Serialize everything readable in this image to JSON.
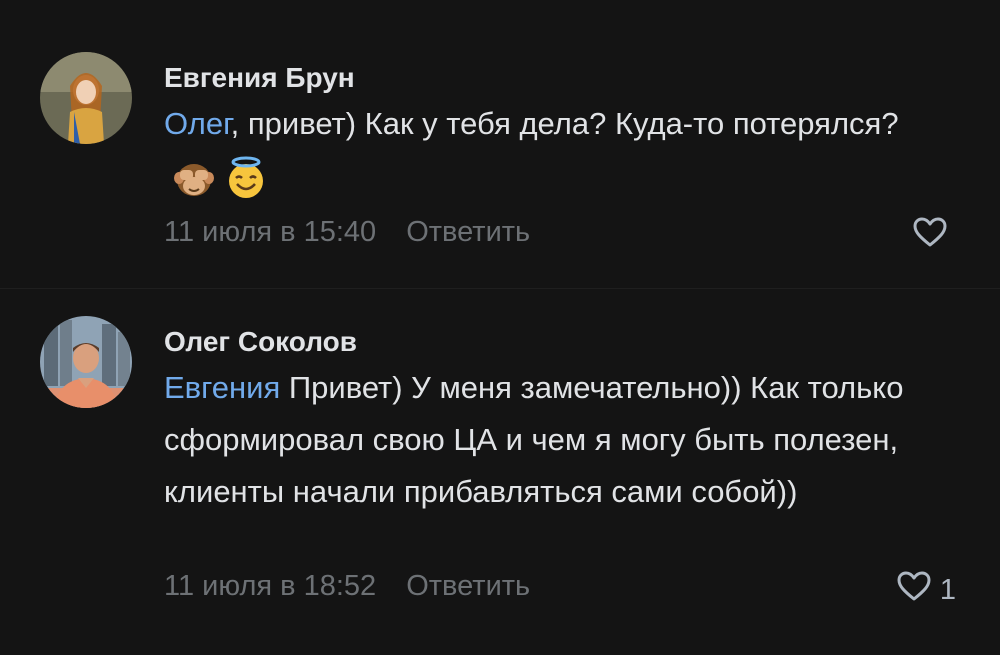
{
  "comments": [
    {
      "author": "Евгения Брун",
      "mention": "Олег",
      "text": ", привет) Как у тебя дела? Куда-то потерялся?",
      "emojis": [
        "see-no-evil-monkey-icon",
        "smiling-face-with-halo-icon"
      ],
      "date": "11 июля в 15:40",
      "reply_label": "Ответить",
      "likes": ""
    },
    {
      "author": "Олег Соколов",
      "mention": "Евгения",
      "text": " Привет) У меня замечательно)) Как только сформировал свою ЦА и чем я могу быть полезен, клиенты начали прибавляться сами собой))",
      "emojis": [],
      "date": "11 июля в 18:52",
      "reply_label": "Ответить",
      "likes": "1"
    }
  ],
  "colors": {
    "background": "#141414",
    "text": "#e1e3e6",
    "mention": "#71aaeb",
    "secondary": "#6d7175",
    "icon": "#aeb7c2"
  }
}
